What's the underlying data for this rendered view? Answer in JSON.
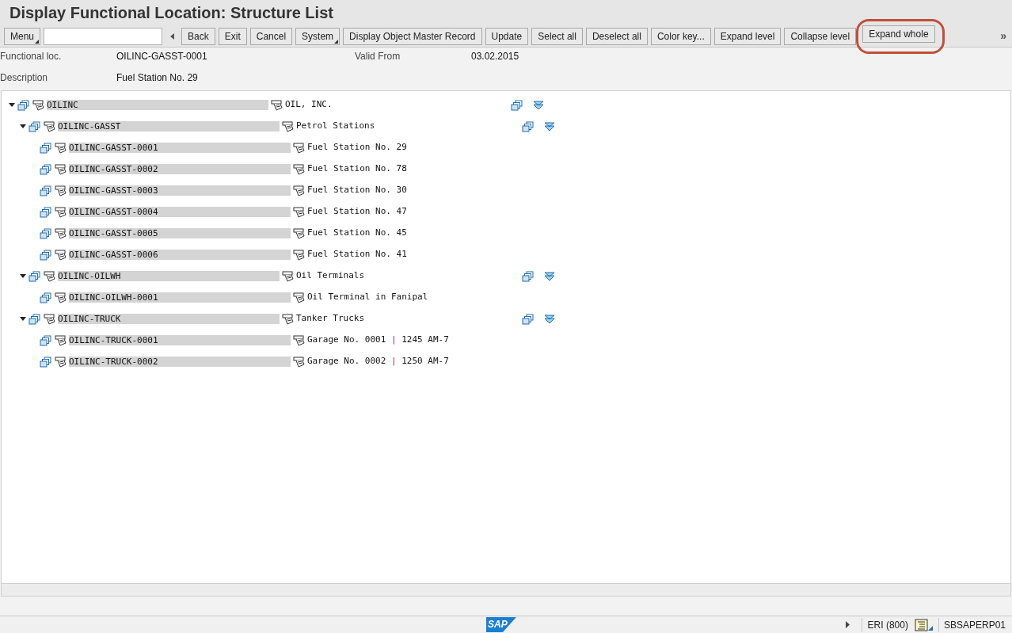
{
  "window": {
    "title": "Display Functional Location: Structure List"
  },
  "toolbar": {
    "menu": "Menu",
    "buttons": [
      {
        "label": "Back",
        "dropdown": false,
        "highlighted": false
      },
      {
        "label": "Exit",
        "dropdown": false,
        "highlighted": false
      },
      {
        "label": "Cancel",
        "dropdown": false,
        "highlighted": false
      },
      {
        "label": "System",
        "dropdown": true,
        "highlighted": false
      },
      {
        "label": "Display Object Master Record",
        "dropdown": false,
        "highlighted": false
      },
      {
        "label": "Update",
        "dropdown": false,
        "highlighted": false
      },
      {
        "label": "Select all",
        "dropdown": false,
        "highlighted": false
      },
      {
        "label": "Deselect all",
        "dropdown": false,
        "highlighted": false
      },
      {
        "label": "Color key...",
        "dropdown": false,
        "highlighted": false
      },
      {
        "label": "Expand level",
        "dropdown": false,
        "highlighted": false
      },
      {
        "label": "Collapse level",
        "dropdown": false,
        "highlighted": false
      },
      {
        "label": "Expand whole",
        "dropdown": false,
        "highlighted": true
      }
    ],
    "overflow": "»"
  },
  "header": {
    "fields": [
      {
        "label": "Functional loc.",
        "value": "OILINC-GASST-0001"
      },
      {
        "label": "Valid From",
        "value": "03.02.2015"
      },
      {
        "label": "Description",
        "value": "Fuel Station No. 29"
      }
    ]
  },
  "tree": [
    {
      "id": "OILINC",
      "description": "OIL, INC.",
      "expanded": true,
      "children": [
        {
          "id": "OILINC-GASST",
          "description": "Petrol Stations",
          "expanded": true,
          "children": [
            {
              "id": "OILINC-GASST-0001",
              "description": "Fuel Station No. 29"
            },
            {
              "id": "OILINC-GASST-0002",
              "description": "Fuel Station No. 78"
            },
            {
              "id": "OILINC-GASST-0003",
              "description": "Fuel Station No. 30"
            },
            {
              "id": "OILINC-GASST-0004",
              "description": "Fuel Station No. 47"
            },
            {
              "id": "OILINC-GASST-0005",
              "description": "Fuel Station No. 45"
            },
            {
              "id": "OILINC-GASST-0006",
              "description": "Fuel Station No. 41"
            }
          ]
        },
        {
          "id": "OILINC-OILWH",
          "description": "Oil Terminals",
          "expanded": true,
          "children": [
            {
              "id": "OILINC-OILWH-0001",
              "description": "Oil Terminal in Fanipal"
            }
          ]
        },
        {
          "id": "OILINC-TRUCK",
          "description": "Tanker Trucks",
          "expanded": true,
          "children": [
            {
              "id": "OILINC-TRUCK-0001",
              "description": "Garage No. 0001 **|** 1245 AM-7"
            },
            {
              "id": "OILINC-TRUCK-0002",
              "description": "Garage No. 0002 **|** 1250 AM-7"
            }
          ]
        }
      ]
    }
  ],
  "status_bar": {
    "logo": "SAP",
    "system": "ERI (800)",
    "server": "SBSAPERP01"
  }
}
